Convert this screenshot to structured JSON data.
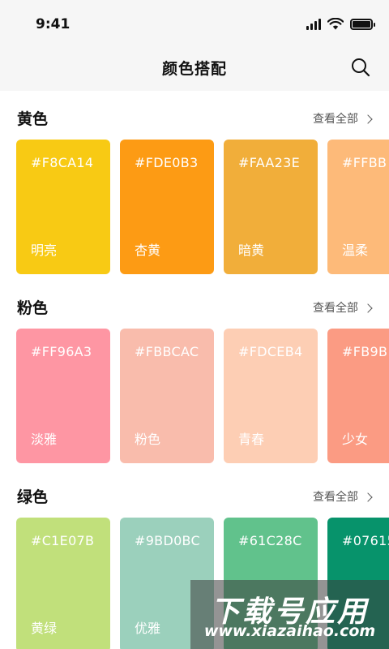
{
  "status_bar": {
    "time": "9:41"
  },
  "nav": {
    "title": "颜色搭配",
    "search_icon": "search-icon"
  },
  "sections": [
    {
      "title": "黄色",
      "view_all": "查看全部",
      "cards": [
        {
          "hex": "#F8CA14",
          "name": "明亮",
          "color": "#F8CA14"
        },
        {
          "hex": "#FDE0B3",
          "name": "杏黄",
          "color": "#FD9B14"
        },
        {
          "hex": "#FAA23E",
          "name": "暗黄",
          "color": "#F1AE3A"
        },
        {
          "hex": "#FFBB",
          "name": "温柔",
          "color": "#FDBA79"
        }
      ]
    },
    {
      "title": "粉色",
      "view_all": "查看全部",
      "cards": [
        {
          "hex": "#FF96A3",
          "name": "淡雅",
          "color": "#FE96A3"
        },
        {
          "hex": "#FBBCAC",
          "name": "粉色",
          "color": "#F9BCAC"
        },
        {
          "hex": "#FDCEB4",
          "name": "青春",
          "color": "#FDCEB4"
        },
        {
          "hex": "#FB9B",
          "name": "少女",
          "color": "#FB9B83"
        }
      ]
    },
    {
      "title": "绿色",
      "view_all": "查看全部",
      "cards": [
        {
          "hex": "#C1E07B",
          "name": "黄绿",
          "color": "#C1E07B"
        },
        {
          "hex": "#9BD0BC",
          "name": "优雅",
          "color": "#9BD0BC"
        },
        {
          "hex": "#61C28C",
          "name": "",
          "color": "#61C28C"
        },
        {
          "hex": "#07615",
          "name": "",
          "color": "#07936B"
        }
      ]
    }
  ],
  "watermark": {
    "text": "下载号应用",
    "url": "www.xiazaihao.com"
  }
}
